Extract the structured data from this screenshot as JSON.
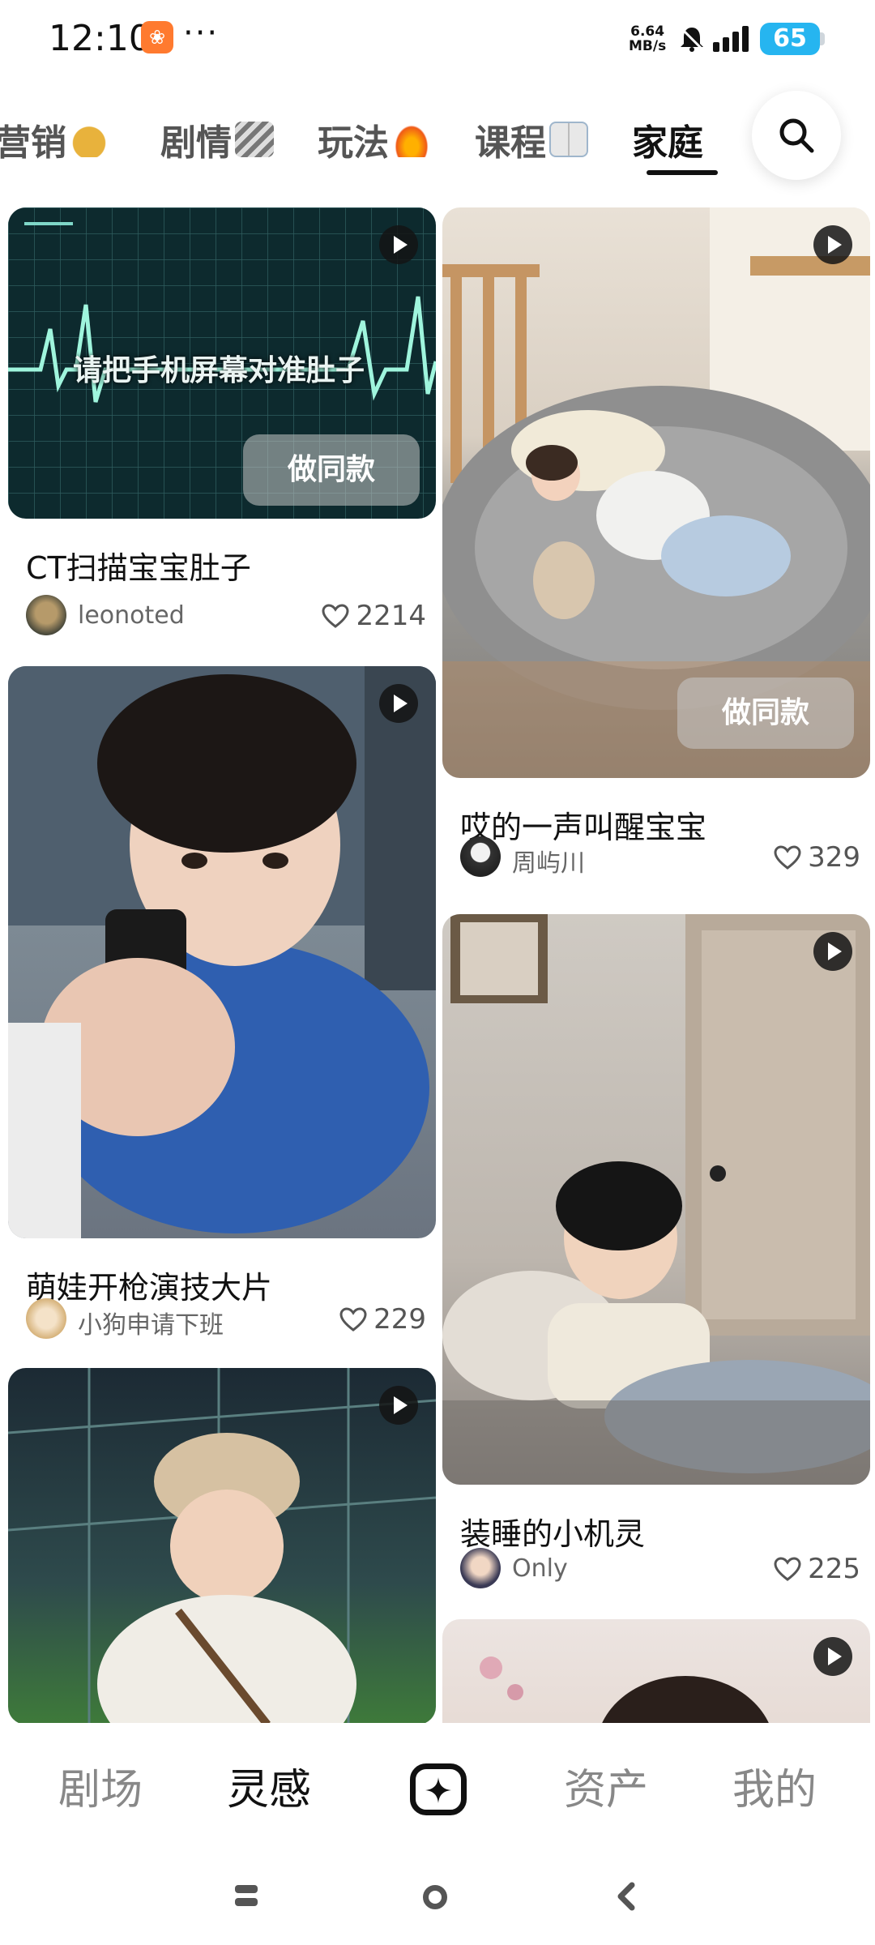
{
  "status_bar": {
    "time": "12:10",
    "more": "···",
    "net_speed_value": "6.64",
    "net_speed_unit": "MB/s",
    "battery": "65"
  },
  "tabs": [
    {
      "label": "营销"
    },
    {
      "label": "剧情"
    },
    {
      "label": "玩法"
    },
    {
      "label": "课程"
    },
    {
      "label": "家庭"
    }
  ],
  "active_tab": "家庭",
  "feed": {
    "cards": [
      {
        "title": "CT扫描宝宝肚子",
        "author": "leonoted",
        "likes": "2214",
        "overlay": "请把手机屏幕对准肚子",
        "button": "做同款"
      },
      {
        "title": "哎的一声叫醒宝宝",
        "author": "周屿川",
        "likes": "329",
        "button": "做同款"
      },
      {
        "title": "萌娃开枪演技大片",
        "author": "小狗申请下班",
        "likes": "229"
      },
      {
        "title": "装睡的小机灵",
        "author": "Only",
        "likes": "225"
      }
    ]
  },
  "bottom_nav": [
    {
      "label": "剧场"
    },
    {
      "label": "灵感"
    },
    {
      "label": "资产"
    },
    {
      "label": "我的"
    }
  ],
  "colors": {
    "battery": "#26b5f0",
    "app_badge": "#ff7a2f",
    "text_primary": "#111111",
    "text_secondary": "#666666"
  }
}
